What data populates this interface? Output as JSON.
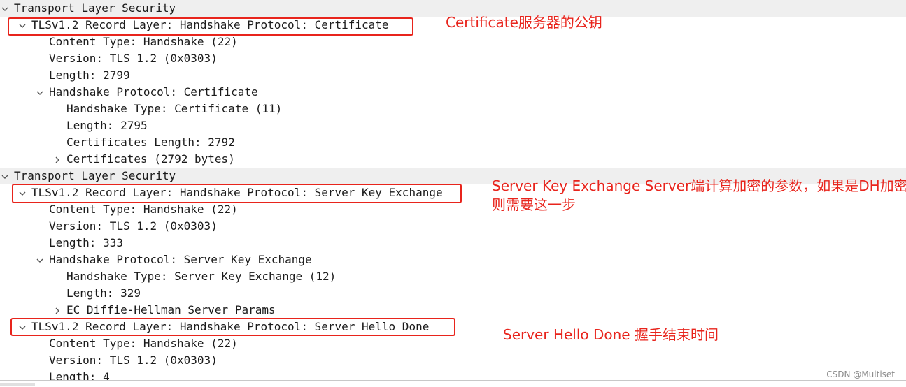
{
  "tree": {
    "rows": [
      {
        "text": "Transport Layer Security",
        "arrow": "down"
      },
      {
        "text": "TLSv1.2 Record Layer: Handshake Protocol: Certificate",
        "arrow": "down"
      },
      {
        "text": "Content Type: Handshake (22)",
        "arrow": "none"
      },
      {
        "text": "Version: TLS 1.2 (0x0303)",
        "arrow": "none"
      },
      {
        "text": "Length: 2799",
        "arrow": "none"
      },
      {
        "text": "Handshake Protocol: Certificate",
        "arrow": "down"
      },
      {
        "text": "Handshake Type: Certificate (11)",
        "arrow": "none"
      },
      {
        "text": "Length: 2795",
        "arrow": "none"
      },
      {
        "text": "Certificates Length: 2792",
        "arrow": "none"
      },
      {
        "text": "Certificates (2792 bytes)",
        "arrow": "right"
      },
      {
        "text": "Transport Layer Security",
        "arrow": "down"
      },
      {
        "text": "TLSv1.2 Record Layer: Handshake Protocol: Server Key Exchange",
        "arrow": "down"
      },
      {
        "text": "Content Type: Handshake (22)",
        "arrow": "none"
      },
      {
        "text": "Version: TLS 1.2 (0x0303)",
        "arrow": "none"
      },
      {
        "text": "Length: 333",
        "arrow": "none"
      },
      {
        "text": "Handshake Protocol: Server Key Exchange",
        "arrow": "down"
      },
      {
        "text": "Handshake Type: Server Key Exchange (12)",
        "arrow": "none"
      },
      {
        "text": "Length: 329",
        "arrow": "none"
      },
      {
        "text": "EC Diffie-Hellman Server Params",
        "arrow": "right"
      },
      {
        "text": "TLSv1.2 Record Layer: Handshake Protocol: Server Hello Done",
        "arrow": "down"
      },
      {
        "text": "Content Type: Handshake (22)",
        "arrow": "none"
      },
      {
        "text": "Version: TLS 1.2 (0x0303)",
        "arrow": "none"
      },
      {
        "text": "Length: 4",
        "arrow": "none"
      }
    ]
  },
  "annotations": {
    "certificate": "Certificate服务器的公钥",
    "server_key_exchange_line1": "Server Key Exchange Server端计算加密的参数，如果是DH加密",
    "server_key_exchange_line2": "则需要这一步",
    "server_hello_done": "Server Hello Done 握手结束时间"
  },
  "colors": {
    "annotation": "#e8241c",
    "text": "#1b1b1b",
    "separator_row": "#efefef",
    "arrow": "#555555"
  },
  "watermark": "CSDN @Multiset"
}
